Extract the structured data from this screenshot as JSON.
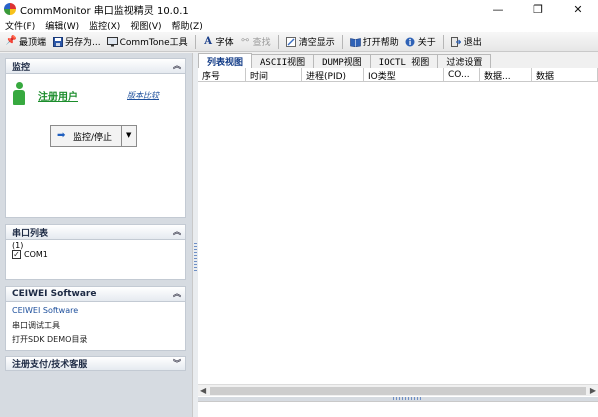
{
  "window": {
    "title": "CommMonitor 串口监视精灵 10.0.1"
  },
  "menu": [
    "文件(F)",
    "编辑(W)",
    "监控(X)",
    "视图(V)",
    "帮助(Z)"
  ],
  "toolbar": {
    "pin": "最顶端",
    "save_as": "另存为...",
    "commtone": "CommTone工具",
    "font": "字体",
    "find": "查找",
    "clear": "清空显示",
    "help": "打开帮助",
    "about": "关于",
    "exit": "退出"
  },
  "monitor_section": {
    "title": "监控",
    "register_link": "注册用户",
    "version_compare": "版本比较",
    "monitor_button": "监控/停止"
  },
  "port_section": {
    "title": "串口列表",
    "group_label": "(1)",
    "ports": [
      {
        "name": "COM1",
        "checked": true
      }
    ]
  },
  "ceiwei_section": {
    "title": "CEIWEI Software",
    "links": [
      "CEIWEI Software",
      "串口调试工具",
      "打开SDK DEMO目录"
    ]
  },
  "support_section": {
    "title": "注册支付/技术客服"
  },
  "tabs": [
    "列表视图",
    "ASCII视图",
    "DUMP视图",
    "IOCTL 视图",
    "过滤设置"
  ],
  "columns": [
    "序号",
    "时间",
    "进程(PID)",
    "IO类型",
    "CO...",
    "数据...",
    "数据"
  ]
}
